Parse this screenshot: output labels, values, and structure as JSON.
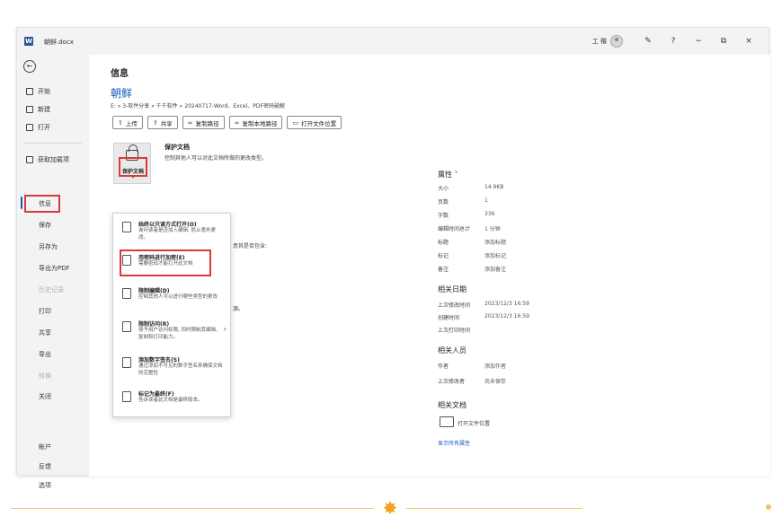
{
  "titlebar": {
    "file_name": "朝鲜.docx",
    "user": "工 楷",
    "controls": {
      "help": "?",
      "minimize": "−",
      "restore": "⧉",
      "close": "×"
    }
  },
  "nav": {
    "back": "←",
    "items": [
      {
        "label": "开始",
        "icon": "home-icon"
      },
      {
        "label": "新建",
        "icon": "new-doc-icon"
      },
      {
        "label": "打开",
        "icon": "open-folder-icon"
      },
      {
        "label": "获取加载项",
        "icon": "addins-icon"
      }
    ],
    "info": "信息",
    "save": "保存",
    "save_as": "另存为",
    "export_pdf": "导出为PDF",
    "history": "历史记录",
    "print": "打印",
    "share": "共享",
    "export": "导出",
    "transform": "转换",
    "close": "关闭",
    "account": "帐户",
    "feedback": "反馈",
    "options": "选项"
  },
  "info": {
    "title": "信息",
    "doc_name": "朝鲜",
    "path": "E: » 3-软件分享 » 千千软件 » 20240717-Word、Excel、PDF密码破解",
    "actions": [
      "上传",
      "共享",
      "复制路径",
      "复制本地路径",
      "打开文件位置"
    ],
    "protect": {
      "tile_label": "保护文档",
      "title": "保护文档",
      "desc": "控制其他人可以对此文档所做的更改类型。",
      "partial_desc_2": "意其是否包含:",
      "partial_desc_3": "源。"
    },
    "protect_menu": [
      {
        "title": "始终以只读方式打开(O)",
        "desc": "询问读者是否加入编辑, 防止意外更改。"
      },
      {
        "title": "用密码进行加密(E)",
        "desc": "需要密码才能打开此文档"
      },
      {
        "title": "限制编辑(D)",
        "desc": "控制其他人可以进行哪些类型的更改"
      },
      {
        "title": "限制访问(R)",
        "desc": "授予用户访问权限, 同时限制其编辑、复制和打印能力。"
      },
      {
        "title": "添加数字签名(S)",
        "desc": "通过添加不可见的数字签名来确保文档的完整性"
      },
      {
        "title": "标记为最终(F)",
        "desc": "告诉读者此文档是最终版本。"
      }
    ]
  },
  "properties": {
    "heading": "属性 ˅",
    "rows": [
      {
        "k": "大小",
        "v": "14.9KB"
      },
      {
        "k": "页数",
        "v": "1"
      },
      {
        "k": "字数",
        "v": "336"
      },
      {
        "k": "编辑时间总计",
        "v": "1 分钟"
      },
      {
        "k": "标题",
        "v": "添加标题"
      },
      {
        "k": "标记",
        "v": "添加标记"
      },
      {
        "k": "备注",
        "v": "添加备注"
      }
    ],
    "dates_heading": "相关日期",
    "dates": [
      {
        "k": "上次修改时间",
        "v": "2023/12/3 16:59"
      },
      {
        "k": "创建时间",
        "v": "2023/12/3 16:59"
      },
      {
        "k": "上次打印时间",
        "v": ""
      }
    ],
    "people_heading": "相关人员",
    "people": [
      {
        "k": "作者",
        "v": "添加作者"
      },
      {
        "k": "上次修改者",
        "v": "尚未保存"
      }
    ],
    "docs_heading": "相关文档",
    "open_location": "打开文件位置",
    "show_all": "显示所有属性"
  }
}
